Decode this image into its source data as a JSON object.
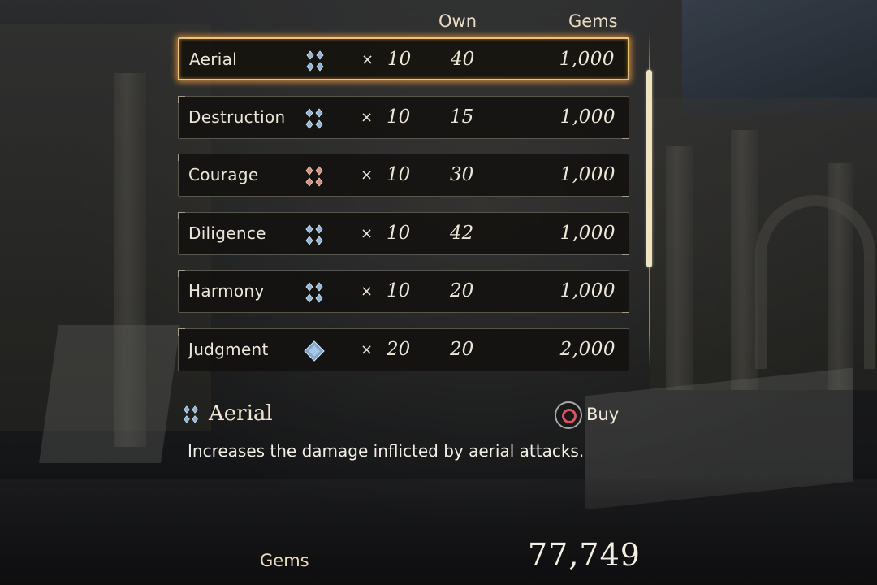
{
  "header": {
    "own": "Own",
    "gems": "Gems"
  },
  "items": [
    {
      "name": "Aerial",
      "icon": "blue-crystal-cluster-icon",
      "times": "×",
      "qty": "10",
      "own": "40",
      "price": "1,000"
    },
    {
      "name": "Destruction",
      "icon": "blue-crystal-cluster-icon",
      "times": "×",
      "qty": "10",
      "own": "15",
      "price": "1,000"
    },
    {
      "name": "Courage",
      "icon": "red-crystal-cluster-icon",
      "times": "×",
      "qty": "10",
      "own": "30",
      "price": "1,000"
    },
    {
      "name": "Diligence",
      "icon": "blue-crystal-cluster-icon",
      "times": "×",
      "qty": "10",
      "own": "42",
      "price": "1,000"
    },
    {
      "name": "Harmony",
      "icon": "blue-crystal-cluster-icon",
      "times": "×",
      "qty": "10",
      "own": "20",
      "price": "1,000"
    },
    {
      "name": "Judgment",
      "icon": "blue-diamond-crystal-icon",
      "times": "×",
      "qty": "20",
      "own": "20",
      "price": "2,000"
    }
  ],
  "selected_index": 0,
  "detail": {
    "title": "Aerial",
    "icon": "blue-crystal-cluster-icon",
    "buy_label": "Buy",
    "buy_button_icon": "circle-button-icon",
    "description": "Increases the damage inflicted by aerial attacks."
  },
  "footer": {
    "label": "Gems",
    "value": "77,749"
  },
  "colors": {
    "highlight": "#f2c27a",
    "blue_crystal": "#8fb4d6",
    "red_crystal": "#d9907c",
    "text": "#ece6d8",
    "buy_circle": "#e0515f"
  }
}
